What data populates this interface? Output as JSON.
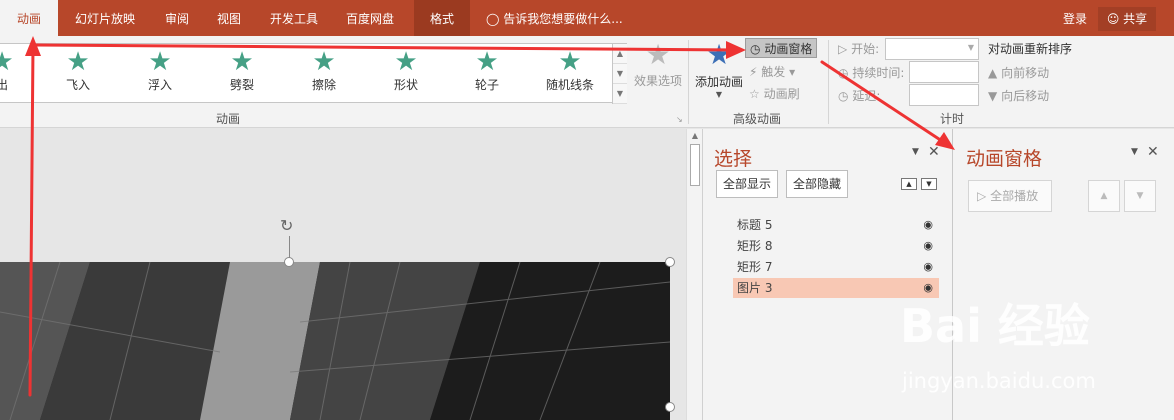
{
  "tabs": [
    {
      "label": "动画",
      "active": true
    },
    {
      "label": "幻灯片放映"
    },
    {
      "label": "审阅"
    },
    {
      "label": "视图"
    },
    {
      "label": "开发工具"
    },
    {
      "label": "百度网盘"
    },
    {
      "label": "格式",
      "contextual": true
    }
  ],
  "tell_me": "告诉我您想要做什么...",
  "account": {
    "login": "登录",
    "share": "共享"
  },
  "gallery": {
    "items": [
      {
        "label": "出",
        "icon": "star-icon"
      },
      {
        "label": "飞入",
        "icon": "star-icon"
      },
      {
        "label": "浮入",
        "icon": "star-icon"
      },
      {
        "label": "劈裂",
        "icon": "star-icon"
      },
      {
        "label": "擦除",
        "icon": "star-icon"
      },
      {
        "label": "形状",
        "icon": "star-icon"
      },
      {
        "label": "轮子",
        "icon": "star-icon"
      },
      {
        "label": "随机线条",
        "icon": "star-icon"
      }
    ],
    "group_label": "动画"
  },
  "effect_options": "效果选项",
  "advanced": {
    "add": "添加动画",
    "pane": "动画窗格",
    "trigger": "触发",
    "painter": "动画刷",
    "group_label": "高级动画"
  },
  "timing": {
    "start": "开始:",
    "duration": "持续时间:",
    "delay": "延迟:",
    "group_label": "计时"
  },
  "reorder": {
    "title": "对动画重新排序",
    "forward": "向前移动",
    "backward": "向后移动"
  },
  "selection_pane": {
    "title": "选择",
    "show_all": "全部显示",
    "hide_all": "全部隐藏",
    "items": [
      {
        "name": "标题 5"
      },
      {
        "name": "矩形 8"
      },
      {
        "name": "矩形 7"
      },
      {
        "name": "图片 3",
        "selected": true
      }
    ]
  },
  "animation_pane": {
    "title": "动画窗格",
    "play_all": "全部播放"
  },
  "watermark": {
    "brand": "Bai  经验",
    "url": "jingyan.baidu.com"
  },
  "colors": {
    "accent": "#b7472a",
    "arrow": "#ee3333"
  }
}
